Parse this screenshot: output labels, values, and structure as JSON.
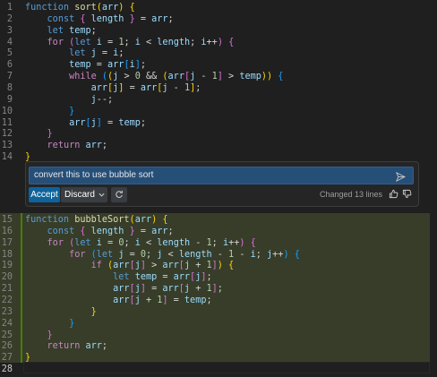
{
  "editor": {
    "top_lines": [
      {
        "n": "1",
        "tokens": [
          [
            "k",
            "function "
          ],
          [
            "f",
            "sort"
          ],
          [
            "b1",
            "("
          ],
          [
            "v",
            "arr"
          ],
          [
            "b1",
            ")"
          ],
          [
            "p",
            " "
          ],
          [
            "b1",
            "{"
          ]
        ]
      },
      {
        "n": "2",
        "tokens": [
          [
            "p",
            "    "
          ],
          [
            "k",
            "const "
          ],
          [
            "b2",
            "{ "
          ],
          [
            "v",
            "length "
          ],
          [
            "b2",
            "}"
          ],
          [
            "p",
            " = "
          ],
          [
            "v",
            "arr"
          ],
          [
            "p",
            ";"
          ]
        ]
      },
      {
        "n": "3",
        "tokens": [
          [
            "p",
            "    "
          ],
          [
            "k",
            "let "
          ],
          [
            "v",
            "temp"
          ],
          [
            "p",
            ";"
          ]
        ]
      },
      {
        "n": "4",
        "tokens": [
          [
            "p",
            "    "
          ],
          [
            "c",
            "for "
          ],
          [
            "b2",
            "("
          ],
          [
            "k",
            "let "
          ],
          [
            "v",
            "i"
          ],
          [
            "p",
            " = "
          ],
          [
            "n",
            "1"
          ],
          [
            "p",
            "; "
          ],
          [
            "v",
            "i"
          ],
          [
            "p",
            " < "
          ],
          [
            "v",
            "length"
          ],
          [
            "p",
            "; "
          ],
          [
            "v",
            "i"
          ],
          [
            "p",
            "++"
          ],
          [
            "b2",
            ")"
          ],
          [
            "p",
            " "
          ],
          [
            "b2",
            "{"
          ]
        ]
      },
      {
        "n": "5",
        "tokens": [
          [
            "p",
            "        "
          ],
          [
            "k",
            "let "
          ],
          [
            "v",
            "j"
          ],
          [
            "p",
            " = "
          ],
          [
            "v",
            "i"
          ],
          [
            "p",
            ";"
          ]
        ]
      },
      {
        "n": "6",
        "tokens": [
          [
            "p",
            "        "
          ],
          [
            "v",
            "temp"
          ],
          [
            "p",
            " = "
          ],
          [
            "v",
            "arr"
          ],
          [
            "b3",
            "["
          ],
          [
            "v",
            "i"
          ],
          [
            "b3",
            "]"
          ],
          [
            "p",
            ";"
          ]
        ]
      },
      {
        "n": "7",
        "tokens": [
          [
            "p",
            "        "
          ],
          [
            "c",
            "while "
          ],
          [
            "b3",
            "("
          ],
          [
            "b1",
            "("
          ],
          [
            "v",
            "j"
          ],
          [
            "p",
            " > "
          ],
          [
            "n",
            "0"
          ],
          [
            "p",
            " && "
          ],
          [
            "b1",
            "("
          ],
          [
            "v",
            "arr"
          ],
          [
            "b2",
            "["
          ],
          [
            "v",
            "j"
          ],
          [
            "p",
            " - "
          ],
          [
            "n",
            "1"
          ],
          [
            "b2",
            "]"
          ],
          [
            "p",
            " > "
          ],
          [
            "v",
            "temp"
          ],
          [
            "b1",
            "))"
          ],
          [
            "p",
            " "
          ],
          [
            "b3",
            "{"
          ]
        ]
      },
      {
        "n": "8",
        "tokens": [
          [
            "p",
            "            "
          ],
          [
            "v",
            "arr"
          ],
          [
            "b1",
            "["
          ],
          [
            "v",
            "j"
          ],
          [
            "b1",
            "]"
          ],
          [
            "p",
            " = "
          ],
          [
            "v",
            "arr"
          ],
          [
            "b1",
            "["
          ],
          [
            "v",
            "j"
          ],
          [
            "p",
            " - "
          ],
          [
            "n",
            "1"
          ],
          [
            "b1",
            "]"
          ],
          [
            "p",
            ";"
          ]
        ]
      },
      {
        "n": "9",
        "tokens": [
          [
            "p",
            "            "
          ],
          [
            "v",
            "j"
          ],
          [
            "p",
            "--;"
          ]
        ]
      },
      {
        "n": "10",
        "tokens": [
          [
            "p",
            "        "
          ],
          [
            "b3",
            "}"
          ]
        ]
      },
      {
        "n": "11",
        "tokens": [
          [
            "p",
            "        "
          ],
          [
            "v",
            "arr"
          ],
          [
            "b3",
            "["
          ],
          [
            "v",
            "j"
          ],
          [
            "b3",
            "]"
          ],
          [
            "p",
            " = "
          ],
          [
            "v",
            "temp"
          ],
          [
            "p",
            ";"
          ]
        ]
      },
      {
        "n": "12",
        "tokens": [
          [
            "p",
            "    "
          ],
          [
            "b2",
            "}"
          ]
        ]
      },
      {
        "n": "13",
        "tokens": [
          [
            "p",
            "    "
          ],
          [
            "c",
            "return "
          ],
          [
            "v",
            "arr"
          ],
          [
            "p",
            ";"
          ]
        ]
      },
      {
        "n": "14",
        "tokens": [
          [
            "b1",
            "}"
          ]
        ]
      }
    ],
    "bottom_lines": [
      {
        "n": "15",
        "tokens": [
          [
            "k",
            "function "
          ],
          [
            "f",
            "bubbleSort"
          ],
          [
            "b1",
            "("
          ],
          [
            "v",
            "arr"
          ],
          [
            "b1",
            ")"
          ],
          [
            "p",
            " "
          ],
          [
            "b1",
            "{"
          ]
        ]
      },
      {
        "n": "16",
        "tokens": [
          [
            "p",
            "    "
          ],
          [
            "k",
            "const "
          ],
          [
            "b2",
            "{ "
          ],
          [
            "v",
            "length "
          ],
          [
            "b2",
            "}"
          ],
          [
            "p",
            " = "
          ],
          [
            "v",
            "arr"
          ],
          [
            "p",
            ";"
          ]
        ]
      },
      {
        "n": "17",
        "tokens": [
          [
            "p",
            "    "
          ],
          [
            "c",
            "for "
          ],
          [
            "b2",
            "("
          ],
          [
            "k",
            "let "
          ],
          [
            "v",
            "i"
          ],
          [
            "p",
            " = "
          ],
          [
            "n",
            "0"
          ],
          [
            "p",
            "; "
          ],
          [
            "v",
            "i"
          ],
          [
            "p",
            " < "
          ],
          [
            "v",
            "length"
          ],
          [
            "p",
            " - "
          ],
          [
            "n",
            "1"
          ],
          [
            "p",
            "; "
          ],
          [
            "v",
            "i"
          ],
          [
            "p",
            "++"
          ],
          [
            "b2",
            ")"
          ],
          [
            "p",
            " "
          ],
          [
            "b2",
            "{"
          ]
        ]
      },
      {
        "n": "18",
        "tokens": [
          [
            "p",
            "        "
          ],
          [
            "c",
            "for "
          ],
          [
            "b3",
            "("
          ],
          [
            "k",
            "let "
          ],
          [
            "v",
            "j"
          ],
          [
            "p",
            " = "
          ],
          [
            "n",
            "0"
          ],
          [
            "p",
            "; "
          ],
          [
            "v",
            "j"
          ],
          [
            "p",
            " < "
          ],
          [
            "v",
            "length"
          ],
          [
            "p",
            " - "
          ],
          [
            "n",
            "1"
          ],
          [
            "p",
            " - "
          ],
          [
            "v",
            "i"
          ],
          [
            "p",
            "; "
          ],
          [
            "v",
            "j"
          ],
          [
            "p",
            "++"
          ],
          [
            "b3",
            ")"
          ],
          [
            "p",
            " "
          ],
          [
            "b3",
            "{"
          ]
        ]
      },
      {
        "n": "19",
        "tokens": [
          [
            "p",
            "            "
          ],
          [
            "c",
            "if "
          ],
          [
            "b1",
            "("
          ],
          [
            "v",
            "arr"
          ],
          [
            "b2",
            "["
          ],
          [
            "v",
            "j"
          ],
          [
            "b2",
            "]"
          ],
          [
            "p",
            " > "
          ],
          [
            "v",
            "arr"
          ],
          [
            "b2",
            "["
          ],
          [
            "v",
            "j"
          ],
          [
            "p",
            " + "
          ],
          [
            "n",
            "1"
          ],
          [
            "b2",
            "]"
          ],
          [
            "b1",
            ")"
          ],
          [
            "p",
            " "
          ],
          [
            "b1",
            "{"
          ]
        ]
      },
      {
        "n": "20",
        "tokens": [
          [
            "p",
            "                "
          ],
          [
            "k",
            "let "
          ],
          [
            "v",
            "temp"
          ],
          [
            "p",
            " = "
          ],
          [
            "v",
            "arr"
          ],
          [
            "b2",
            "["
          ],
          [
            "v",
            "j"
          ],
          [
            "b2",
            "]"
          ],
          [
            "p",
            ";"
          ]
        ]
      },
      {
        "n": "21",
        "tokens": [
          [
            "p",
            "                "
          ],
          [
            "v",
            "arr"
          ],
          [
            "b2",
            "["
          ],
          [
            "v",
            "j"
          ],
          [
            "b2",
            "]"
          ],
          [
            "p",
            " = "
          ],
          [
            "v",
            "arr"
          ],
          [
            "b2",
            "["
          ],
          [
            "v",
            "j"
          ],
          [
            "p",
            " + "
          ],
          [
            "n",
            "1"
          ],
          [
            "b2",
            "]"
          ],
          [
            "p",
            ";"
          ]
        ]
      },
      {
        "n": "22",
        "tokens": [
          [
            "p",
            "                "
          ],
          [
            "v",
            "arr"
          ],
          [
            "b2",
            "["
          ],
          [
            "v",
            "j"
          ],
          [
            "p",
            " + "
          ],
          [
            "n",
            "1"
          ],
          [
            "b2",
            "]"
          ],
          [
            "p",
            " = "
          ],
          [
            "v",
            "temp"
          ],
          [
            "p",
            ";"
          ]
        ]
      },
      {
        "n": "23",
        "tokens": [
          [
            "p",
            "            "
          ],
          [
            "b1",
            "}"
          ]
        ]
      },
      {
        "n": "24",
        "tokens": [
          [
            "p",
            "        "
          ],
          [
            "b3",
            "}"
          ]
        ]
      },
      {
        "n": "25",
        "tokens": [
          [
            "p",
            "    "
          ],
          [
            "b2",
            "}"
          ]
        ]
      },
      {
        "n": "26",
        "tokens": [
          [
            "p",
            "    "
          ],
          [
            "c",
            "return "
          ],
          [
            "v",
            "arr"
          ],
          [
            "p",
            ";"
          ]
        ]
      },
      {
        "n": "27",
        "tokens": [
          [
            "b1",
            "}"
          ]
        ]
      },
      {
        "n": "28",
        "tokens": []
      }
    ]
  },
  "chat": {
    "prompt": "convert this to use bubble sort",
    "accept_label": "Accept",
    "discard_label": "Discard",
    "changed_text": "Changed 13 lines"
  },
  "icons": {
    "send": "send-icon",
    "dropdown": "chevron-down-icon",
    "regenerate": "refresh-icon",
    "thumbs_up": "thumbs-up-icon",
    "thumbs_down": "thumbs-down-icon"
  },
  "colors": {
    "accent": "#0e639c",
    "diff_added": "#373d29",
    "keyword": "#569cd6",
    "control": "#c586c0",
    "function": "#dcdcaa",
    "variable": "#9cdcfe"
  }
}
